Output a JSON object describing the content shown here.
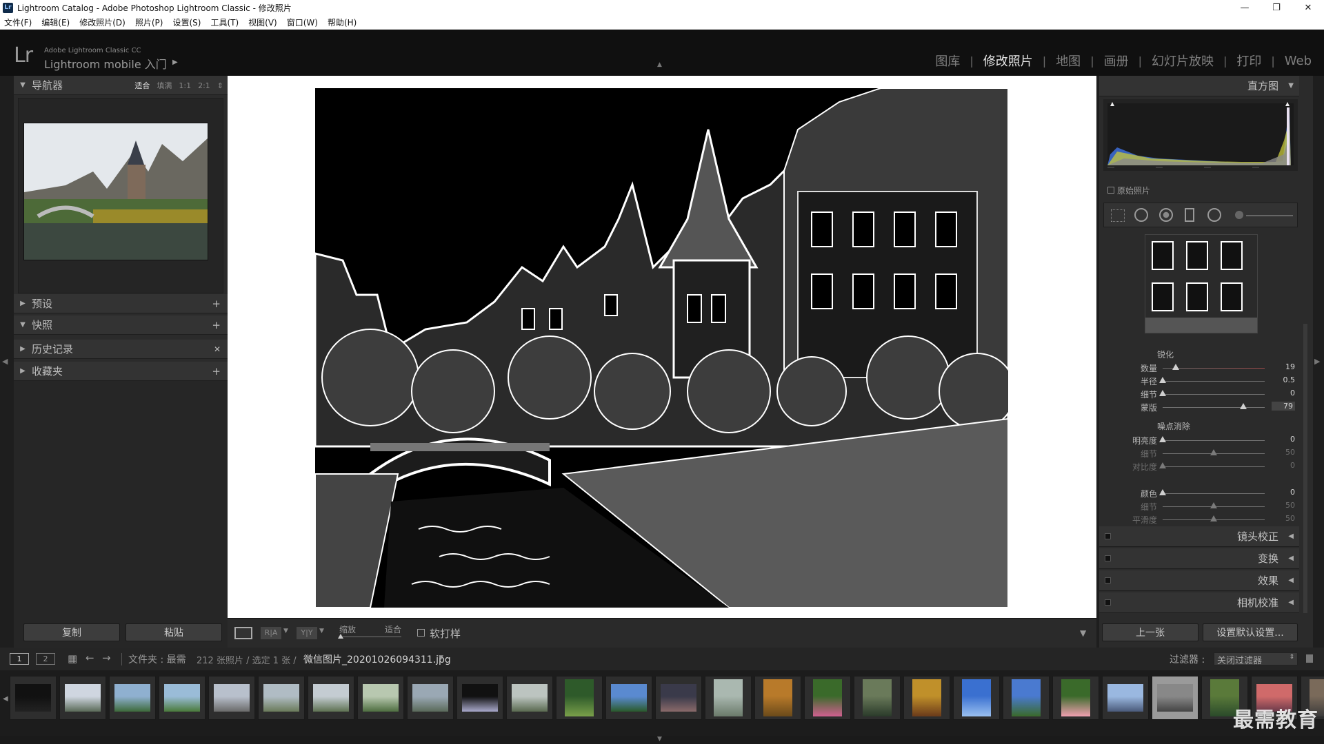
{
  "window": {
    "title": "Lightroom Catalog - Adobe Photoshop Lightroom Classic - 修改照片",
    "app_badge": "Lr",
    "controls": {
      "minimize": "—",
      "restore": "❐",
      "close": "✕"
    }
  },
  "menu": [
    "文件(F)",
    "编辑(E)",
    "修改照片(D)",
    "照片(P)",
    "设置(S)",
    "工具(T)",
    "视图(V)",
    "窗口(W)",
    "帮助(H)"
  ],
  "identity": {
    "logo": "Lr",
    "product": "Adobe Lightroom Classic CC",
    "mobile": "Lightroom mobile 入门"
  },
  "modules": [
    {
      "label": "图库",
      "active": false
    },
    {
      "label": "修改照片",
      "active": true
    },
    {
      "label": "地图",
      "active": false
    },
    {
      "label": "画册",
      "active": false
    },
    {
      "label": "幻灯片放映",
      "active": false
    },
    {
      "label": "打印",
      "active": false
    },
    {
      "label": "Web",
      "active": false
    }
  ],
  "navigator": {
    "title": "导航器",
    "zoom": [
      "适合",
      "填满",
      "1:1",
      "2:1"
    ],
    "zoom_active": "适合"
  },
  "left_panels": [
    {
      "label": "预设",
      "action": "+"
    },
    {
      "label": "快照",
      "action": "+"
    },
    {
      "label": "历史记录",
      "action": "✕"
    },
    {
      "label": "收藏夹",
      "action": "+"
    }
  ],
  "left_buttons": {
    "copy": "复制",
    "paste": "粘贴"
  },
  "toolbar": {
    "zoom_label": "缩放",
    "fit_label": "适合",
    "soft_proof": "软打样",
    "ra_label": "R|A",
    "yy_label": "Y|Y"
  },
  "histogram": {
    "title": "直方图",
    "original_photo": "原始照片"
  },
  "detail": {
    "sharpen_title": "锐化",
    "sharpen": [
      {
        "label": "数量",
        "value": "19",
        "pos": 0.13,
        "dim": false,
        "red": true
      },
      {
        "label": "半径",
        "value": "0.5",
        "pos": 0.0,
        "dim": false,
        "red": false
      },
      {
        "label": "细节",
        "value": "0",
        "pos": 0.0,
        "dim": false,
        "red": false
      },
      {
        "label": "蒙版",
        "value": "79",
        "pos": 0.79,
        "dim": false,
        "red": false,
        "boxed": true
      }
    ],
    "noise_title": "噪点消除",
    "noise": [
      {
        "label": "明亮度",
        "value": "0",
        "pos": 0.0,
        "dim": false
      },
      {
        "label": "细节",
        "value": "50",
        "pos": 0.5,
        "dim": true
      },
      {
        "label": "对比度",
        "value": "0",
        "pos": 0.0,
        "dim": true
      },
      {
        "label": "颜色",
        "value": "0",
        "pos": 0.0,
        "dim": false
      },
      {
        "label": "细节",
        "value": "50",
        "pos": 0.5,
        "dim": true
      },
      {
        "label": "平滑度",
        "value": "50",
        "pos": 0.5,
        "dim": true
      }
    ]
  },
  "right_panels": [
    "镜头校正",
    "变换",
    "效果",
    "相机校准"
  ],
  "right_buttons": {
    "previous": "上一张",
    "defaults": "设置默认设置..."
  },
  "filmbar": {
    "page1": "1",
    "page2": "2",
    "folder_label": "文件夹 : 最需",
    "count": "212 张照片 / 选定 1 张 /",
    "filename": "微信图片_20201026094311.jpg",
    "filter_label": "过滤器 :",
    "filter_value": "关闭过滤器"
  },
  "watermark": "最需教育",
  "colors": {
    "accent_active": "#e6e6e6",
    "panel_bg": "#2b2b2b",
    "header_bg": "#101010"
  }
}
